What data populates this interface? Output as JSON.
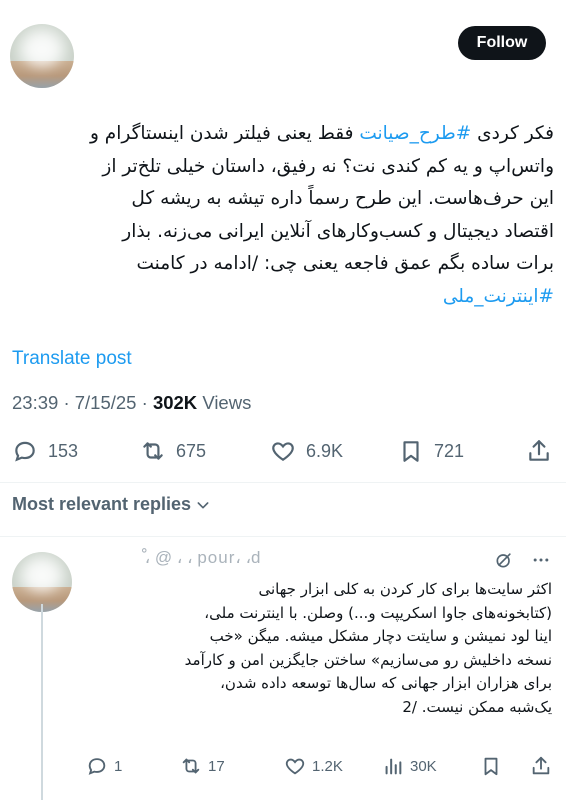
{
  "post": {
    "follow_label": "Follow",
    "text_line1_prefix": "فکر کردی ",
    "hashtag_plan": "#طرح_صیانت",
    "text_line1_suffix": " فقط یعنی فیلتر شدن اینستاگرام و",
    "text_line2": "واتس‌اپ و یه کم کندی نت؟ نه رفیق، داستان خیلی تلخ‌تر از",
    "text_line3": "این حرف‌هاست. این طرح رسماً داره تیشه به ریشه کل",
    "text_line4": "اقتصاد دیجیتال و کسب‌وکارهای آنلاین ایرانی می‌زنه. بذار",
    "text_line5": "برات ساده بگم عمق فاجعه یعنی چی:  /ادامه در کامنت",
    "hashtag_national": "#اینترنت_ملی",
    "translate_label": "Translate post",
    "time": "23:39",
    "date": "7/15/25",
    "views_count": "302K",
    "views_label": "Views",
    "stats": {
      "replies": "153",
      "reposts": "675",
      "likes": "6.9K",
      "bookmarks": "721"
    }
  },
  "replies_header": "Most relevant replies",
  "reply": {
    "username": "ْ ، @ ، ، pour، ،d",
    "lines": [
      "اکثر سایت‌ها برای کار کردن به کلی ابزار جهانی",
      "(کتابخونه‌های جاوا اسکریپت و...) وصلن. با اینترنت ملی،",
      "اینا لود نمیشن و سایتت دچار مشکل میشه. میگن «خب",
      "نسخه داخلیش رو می‌سازیم» ساختن جایگزین امن و کارآمد",
      "برای هزاران ابزار جهانی که سال‌ها توسعه داده شدن،",
      "یک‌شبه ممکن نیست. /2"
    ],
    "stats": {
      "replies": "1",
      "reposts": "17",
      "likes": "1.2K",
      "views": "30K"
    }
  },
  "colors": {
    "accent": "#1d9bf0",
    "text": "#0f1419",
    "muted": "#536471",
    "follow_bg": "#0f1419"
  }
}
